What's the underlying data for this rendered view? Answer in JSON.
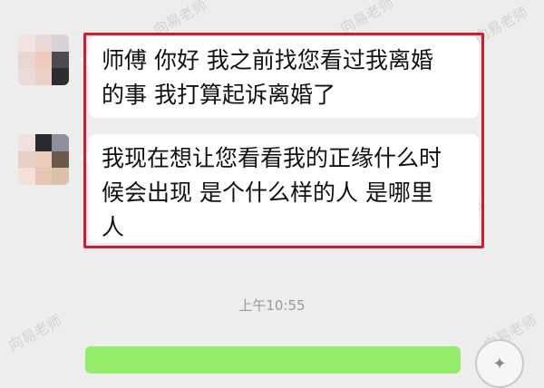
{
  "watermarks": [
    "向易老师",
    "向易老师",
    "向易老师",
    "向易老师",
    "向易老师",
    "向易老师"
  ],
  "messages": [
    {
      "line1": "师傅 你好 我之前找您看过我离婚",
      "line2": "的事 我打算起诉离婚了"
    },
    {
      "line1": "我现在想让您看看我的正缘什么时",
      "line2": "候会出现 是个什么样的人  是哪里",
      "line3": "人"
    }
  ],
  "timestamp": "上午10:55",
  "colors": {
    "highlight": "#d21c2b",
    "self_bubble": "#95ec69",
    "background": "#ededed"
  },
  "icons": {
    "avatar": "blurred-avatar"
  }
}
